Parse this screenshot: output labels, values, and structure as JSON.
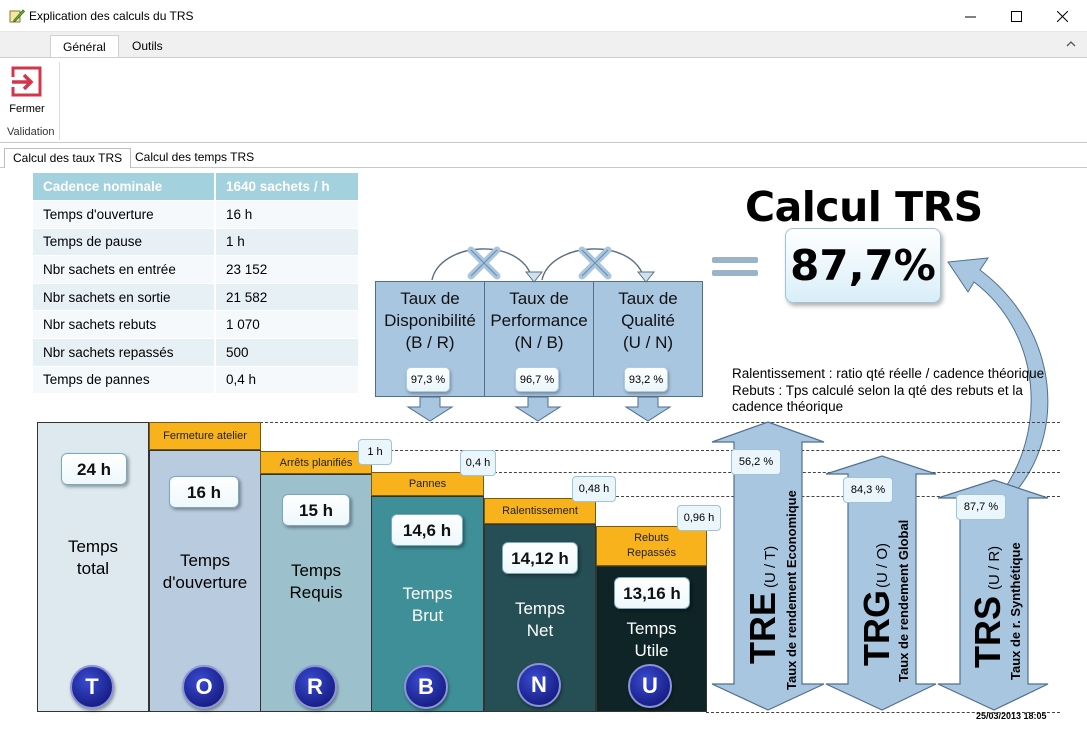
{
  "window": {
    "title": "Explication des calculs du TRS"
  },
  "ribbon": {
    "tabs": [
      "Général",
      "Outils"
    ],
    "close_label": "Fermer",
    "group_label": "Validation"
  },
  "page_tabs": [
    "Calcul des taux TRS",
    "Calcul des temps TRS"
  ],
  "params": {
    "header": {
      "label": "Cadence nominale",
      "value": "1640 sachets / h"
    },
    "rows": [
      {
        "label": "Temps d'ouverture",
        "value": "16 h"
      },
      {
        "label": "Temps de pause",
        "value": "1 h"
      },
      {
        "label": "Nbr sachets en entrée",
        "value": "23 152"
      },
      {
        "label": "Nbr sachets en sortie",
        "value": "21 582"
      },
      {
        "label": "Nbr sachets rebuts",
        "value": "1 070"
      },
      {
        "label": "Nbr sachets repassés",
        "value": "500"
      },
      {
        "label": "Temps de pannes",
        "value": "0,4 h"
      }
    ]
  },
  "calc": {
    "title": "Calcul TRS",
    "result": "87,7%"
  },
  "rates": [
    {
      "line1": "Taux de",
      "line2": "Disponibilité",
      "line3": "(B / R)",
      "pct": "97,3 %"
    },
    {
      "line1": "Taux de",
      "line2": "Performance",
      "line3": "(N / B)",
      "pct": "96,7 %"
    },
    {
      "line1": "Taux de",
      "line2": "Qualité",
      "line3": "(U / N)",
      "pct": "93,2 %"
    }
  ],
  "notes": {
    "line1": "Ralentissement : ratio qté réelle / cadence théorique",
    "line2": "Rebuts : Tps calculé selon la qté des rebuts et la cadence théorique"
  },
  "columns": [
    {
      "header": "",
      "value": "24 h",
      "name1": "Temps",
      "name2": "total",
      "letter": "T",
      "loss": ""
    },
    {
      "header": "Fermeture  atelier",
      "value": "16 h",
      "name1": "Temps",
      "name2": "d'ouverture",
      "letter": "O",
      "loss": ""
    },
    {
      "header": "Arrêts planifiés",
      "value": "15 h",
      "name1": "Temps",
      "name2": "Requis",
      "letter": "R",
      "loss": "1 h"
    },
    {
      "header": "Pannes",
      "value": "14,6 h",
      "name1": "Temps",
      "name2": "Brut",
      "letter": "B",
      "loss": "0,4 h"
    },
    {
      "header": "Ralentissement",
      "value": "14,12 h",
      "name1": "Temps",
      "name2": "Net",
      "letter": "N",
      "loss": "0,48 h"
    },
    {
      "header": "Rebuts Repassés",
      "header1": "Rebuts",
      "header2": "Repassés",
      "value": "13,16 h",
      "name1": "Temps",
      "name2": "Utile",
      "letter": "U",
      "loss": "0,96 h"
    }
  ],
  "indicators": [
    {
      "abbr": "TRE",
      "ratio": "(U / T)",
      "full": "Taux de rendement Economique",
      "pct": "56,2 %"
    },
    {
      "abbr": "TRG",
      "ratio": "(U / O)",
      "full": "Taux de rendement Global",
      "pct": "84,3 %"
    },
    {
      "abbr": "TRS",
      "ratio": "(U / R)",
      "full": "Taux de r. Synthétique",
      "pct": "87,7 %"
    }
  ],
  "timestamp": "25/03/2013 18:05",
  "colors": {
    "accent_orange": "#f7b21c",
    "circle_blue": "#1b238f",
    "rate_box": "#a9c6e1"
  }
}
